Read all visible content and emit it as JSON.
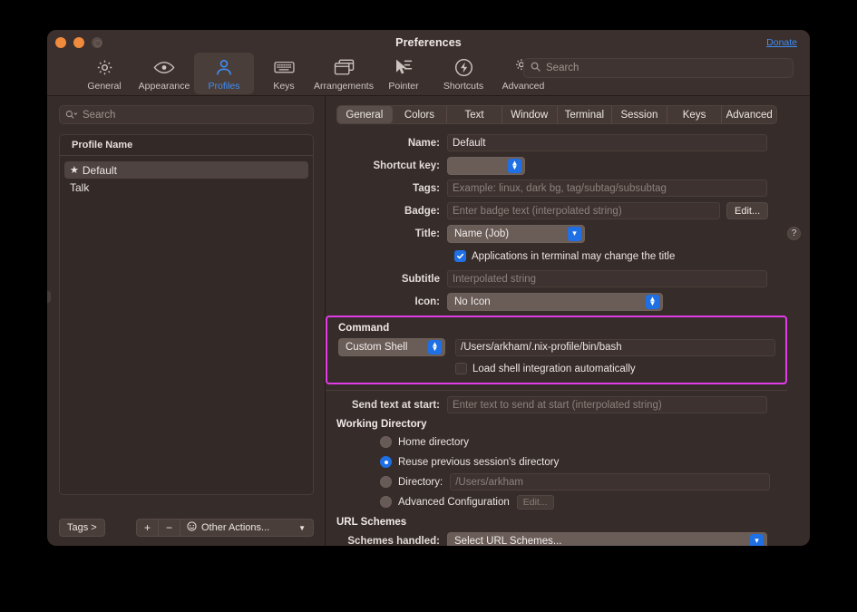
{
  "window": {
    "title": "Preferences",
    "donate_label": "Donate"
  },
  "toolbar": {
    "items": [
      {
        "label": "General",
        "icon": "gear-icon"
      },
      {
        "label": "Appearance",
        "icon": "eye-icon"
      },
      {
        "label": "Profiles",
        "icon": "person-icon"
      },
      {
        "label": "Keys",
        "icon": "keyboard-icon"
      },
      {
        "label": "Arrangements",
        "icon": "windows-icon"
      },
      {
        "label": "Pointer",
        "icon": "cursor-icon"
      },
      {
        "label": "Shortcuts",
        "icon": "bolt-icon"
      },
      {
        "label": "Advanced",
        "icon": "gears-icon"
      }
    ],
    "selected": "Profiles",
    "search_placeholder": "Search"
  },
  "sidebar": {
    "search_placeholder": "Search",
    "column_header": "Profile Name",
    "profiles": [
      {
        "name": "Default",
        "default": true
      },
      {
        "name": "Talk",
        "default": false
      }
    ],
    "selected_profile": "Default",
    "tags_button": "Tags >",
    "add_button": "+",
    "remove_button": "−",
    "other_actions_label": "Other Actions..."
  },
  "tabs": [
    "General",
    "Colors",
    "Text",
    "Window",
    "Terminal",
    "Session",
    "Keys",
    "Advanced"
  ],
  "selected_tab": "General",
  "general": {
    "name_label": "Name:",
    "name_value": "Default",
    "shortcut_label": "Shortcut key:",
    "shortcut_value": "",
    "tags_label": "Tags:",
    "tags_placeholder": "Example: linux, dark bg, tag/subtag/subsubtag",
    "badge_label": "Badge:",
    "badge_placeholder": "Enter badge text (interpolated string)",
    "badge_edit_button": "Edit...",
    "title_label": "Title:",
    "title_value": "Name (Job)",
    "help_glyph": "?",
    "apps_change_title_label": "Applications in terminal may change the title",
    "apps_change_title_checked": true,
    "subtitle_label": "Subtitle",
    "subtitle_placeholder": "Interpolated string",
    "icon_label": "Icon:",
    "icon_value": "No Icon"
  },
  "command": {
    "section_title": "Command",
    "shell_value": "Custom Shell",
    "command_path": "/Users/arkham/.nix-profile/bin/bash",
    "load_shell_integration_label": "Load shell integration automatically",
    "load_shell_integration_checked": false,
    "highlight_color": "#e23ce8"
  },
  "send_text": {
    "label": "Send text at start:",
    "placeholder": "Enter text to send at start (interpolated string)"
  },
  "working_directory": {
    "section_title": "Working Directory",
    "options": [
      {
        "label": "Home directory",
        "selected": false
      },
      {
        "label": "Reuse previous session's directory",
        "selected": true
      },
      {
        "label": "Directory:",
        "selected": false
      },
      {
        "label": "Advanced Configuration",
        "selected": false
      }
    ],
    "directory_value": "/Users/arkham",
    "advanced_edit_button": "Edit..."
  },
  "url_schemes": {
    "section_title": "URL Schemes",
    "schemes_label": "Schemes handled:",
    "schemes_value": "Select URL Schemes..."
  }
}
